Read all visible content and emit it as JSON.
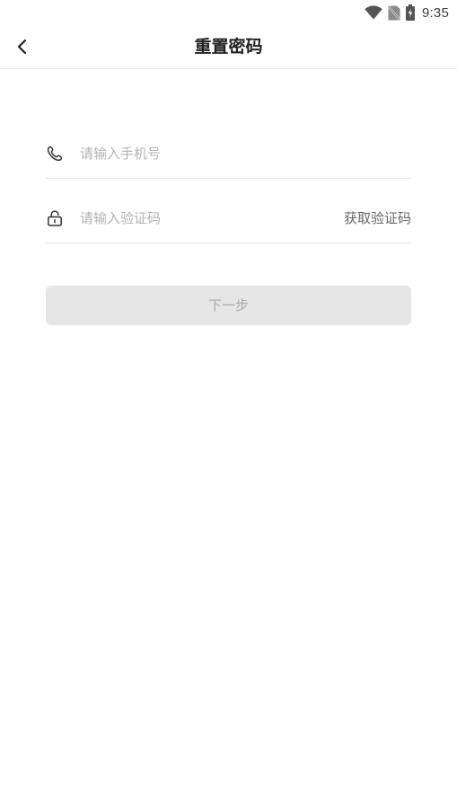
{
  "status_bar": {
    "time": "9:35",
    "icons": [
      "wifi-icon",
      "no-sim-icon",
      "battery-charging-icon"
    ]
  },
  "nav": {
    "back_icon": "chevron-left-icon",
    "title": "重置密码"
  },
  "form": {
    "phone": {
      "icon": "phone-icon",
      "value": "",
      "placeholder": "请输入手机号"
    },
    "code": {
      "icon": "lock-icon",
      "value": "",
      "placeholder": "请输入验证码",
      "get_code_label": "获取验证码"
    },
    "next_label": "下一步"
  },
  "colors": {
    "button_disabled_bg": "#e6e6e6",
    "button_disabled_text": "#a9a9a9",
    "placeholder": "#b3b3b3",
    "divider": "#e6e6e6",
    "title": "#222222"
  }
}
